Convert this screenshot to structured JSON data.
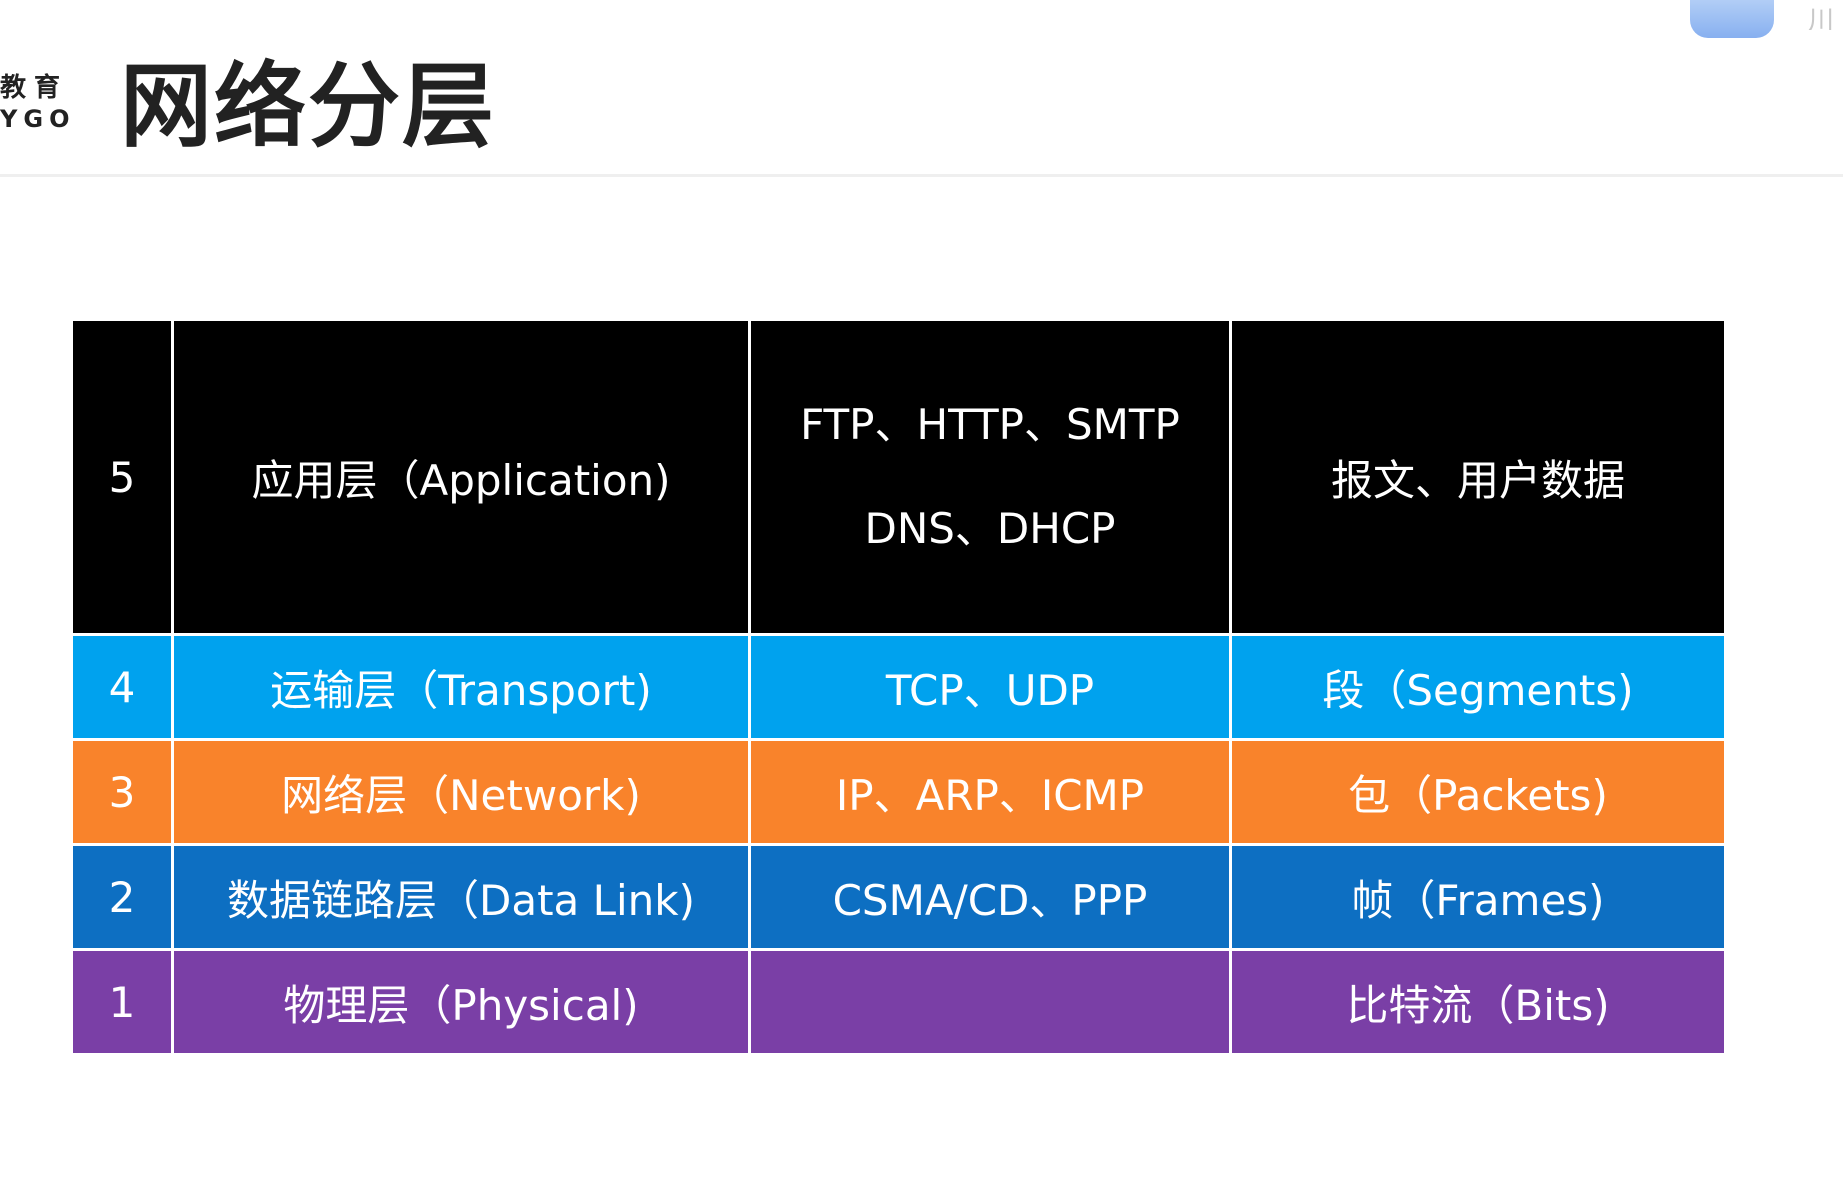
{
  "brand": {
    "cn": "教育",
    "en": "YGO"
  },
  "title": "网络分层",
  "corner": {
    "text": "川"
  },
  "colors": {
    "application": "#000000",
    "transport": "#00a2ee",
    "network": "#f9832b",
    "data_link": "#0d6fc2",
    "physical": "#7a3fa6"
  },
  "layers": [
    {
      "number": "5",
      "name": "应用层（Application)",
      "protocols": [
        "FTP、HTTP、SMTP",
        "DNS、DHCP"
      ],
      "unit": "报文、用户数据"
    },
    {
      "number": "4",
      "name": "运输层（Transport)",
      "protocols": [
        "TCP、UDP"
      ],
      "unit": "段（Segments)"
    },
    {
      "number": "3",
      "name": "网络层（Network)",
      "protocols": [
        "IP、ARP、ICMP"
      ],
      "unit": "包（Packets)"
    },
    {
      "number": "2",
      "name": "数据链路层（Data Link)",
      "protocols": [
        "CSMA/CD、PPP"
      ],
      "unit": "帧（Frames)"
    },
    {
      "number": "1",
      "name": "物理层（Physical)",
      "protocols": [],
      "unit": "比特流（Bits)"
    }
  ]
}
